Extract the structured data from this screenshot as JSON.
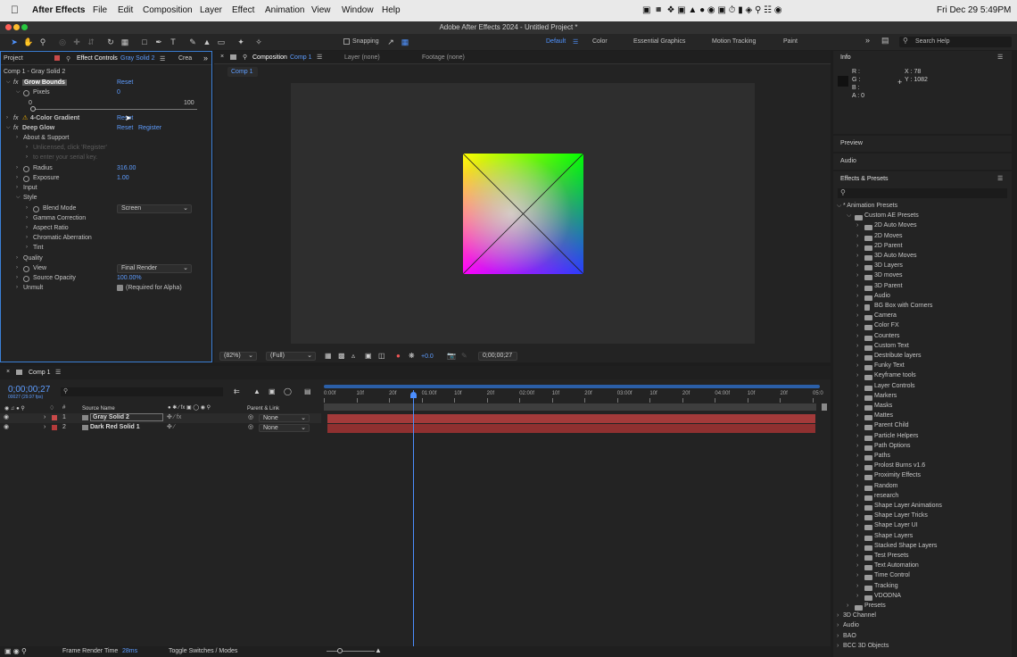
{
  "menubar": {
    "app_name": "After Effects",
    "items": [
      "File",
      "Edit",
      "Composition",
      "Layer",
      "Effect",
      "Animation",
      "View",
      "Window",
      "Help"
    ],
    "clock": "Fri Dec 29  5:49PM"
  },
  "window_title": "Adobe After Effects 2024 - Untitled Project *",
  "toolbar": {
    "snapping_label": "Snapping",
    "workspaces": [
      "Default",
      "Color",
      "Essential Graphics",
      "Motion Tracking",
      "Paint"
    ],
    "search_placeholder": "Search Help"
  },
  "effect_controls": {
    "tab_project": "Project",
    "tab_label": "Effect Controls",
    "tab_layer": "Gray Solid 2",
    "tab_extra": "Crea",
    "breadcrumb": "Comp 1 - Gray Solid 2",
    "rows": [
      {
        "indent": 0,
        "fx": true,
        "label": "Grow Bounds",
        "value": "Reset",
        "highlight": true
      },
      {
        "indent": 1,
        "stopwatch": true,
        "label": "Pixels",
        "value": "0"
      },
      {
        "indent": 1,
        "label": "",
        "value": ""
      },
      {
        "indent": 0,
        "fx": true,
        "warn": true,
        "label": "4-Color Gradient",
        "value": "Reset"
      },
      {
        "indent": 0,
        "fx": true,
        "label": "Deep Glow",
        "value": "Reset",
        "value2": "Register"
      },
      {
        "indent": 1,
        "label": "About & Support",
        "value": ""
      },
      {
        "indent": 2,
        "label": "Unlicensed, click 'Register'",
        "value": "",
        "dim": true
      },
      {
        "indent": 2,
        "label": "to enter your serial key.",
        "value": "",
        "dim": true
      },
      {
        "indent": 1,
        "stopwatch": true,
        "label": "Radius",
        "value": "316.00"
      },
      {
        "indent": 1,
        "stopwatch": true,
        "label": "Exposure",
        "value": "1.00"
      },
      {
        "indent": 1,
        "label": "Input",
        "value": ""
      },
      {
        "indent": 1,
        "label": "Style",
        "value": ""
      },
      {
        "indent": 2,
        "stopwatch": true,
        "label": "Blend Mode",
        "select": "Screen"
      },
      {
        "indent": 2,
        "label": "Gamma Correction",
        "value": ""
      },
      {
        "indent": 2,
        "label": "Aspect Ratio",
        "value": ""
      },
      {
        "indent": 2,
        "label": "Chromatic Aberration",
        "value": ""
      },
      {
        "indent": 2,
        "label": "Tint",
        "value": ""
      },
      {
        "indent": 1,
        "label": "Quality",
        "value": ""
      },
      {
        "indent": 1,
        "stopwatch": true,
        "label": "View",
        "select": "Final Render"
      },
      {
        "indent": 1,
        "stopwatch": true,
        "label": "Source Opacity",
        "value": "100.00%"
      },
      {
        "indent": 1,
        "label": "Unmult",
        "checkbox": "(Required for Alpha)"
      }
    ],
    "slider_min": "0",
    "slider_max": "100"
  },
  "composition": {
    "tab_label": "Composition",
    "tab_comp": "Comp 1",
    "tab_layer": "Layer (none)",
    "tab_footage": "Footage (none)",
    "subtab": "Comp 1",
    "zoom": "(82%)",
    "resolution": "(Full)",
    "exposure": "+0.0",
    "timecode": "0;00;00;27"
  },
  "info": {
    "title": "Info",
    "r": "R :",
    "g": "G :",
    "b": "B :",
    "a": "A :  0",
    "x": "X : 78",
    "y": "Y : 1082"
  },
  "side_panels": {
    "preview": "Preview",
    "audio": "Audio",
    "effects_presets": "Effects & Presets"
  },
  "presets": {
    "root": "* Animation Presets",
    "custom": "Custom AE Presets",
    "folders": [
      "2D Auto Moves",
      "2D Moves",
      "2D Parent",
      "3D Auto Moves",
      "3D Layers",
      "3D moves",
      "3D Parent",
      "Audio",
      "BG Box with Corners",
      "Camera",
      "Color FX",
      "Counters",
      "Custom Text",
      "Destribute layers",
      "Funky Text",
      "Keyframe tools",
      "Layer Controls",
      "Markers",
      "Masks",
      "Mattes",
      "Parent Child",
      "Particle Helpers",
      "Path Options",
      "Paths",
      "Prolost Burns v1.6",
      "Proximity Effects",
      "Random",
      "research",
      "Shape Layer Animations",
      "Shape Layer Tricks",
      "Shape Layer UI",
      "Shape Layers",
      "Stacked Shape Layers",
      "Test Presets",
      "Text Automation",
      "Time Control",
      "Tracking",
      "VDODNA"
    ],
    "presets_label": "Presets",
    "bottom": [
      "3D Channel",
      "Audio",
      "BAO",
      "BCC 3D Objects"
    ]
  },
  "timeline": {
    "tab": "Comp 1",
    "timecode": "0;00;00;27",
    "fps": "00027 (29.97 fps)",
    "col_source": "Source Name",
    "col_parent": "Parent & Link",
    "layers": [
      {
        "num": "1",
        "name": "Gray Solid 2",
        "parent": "None",
        "color": "#c94a4a"
      },
      {
        "num": "2",
        "name": "Dark Red Solid 1",
        "parent": "None",
        "color": "#b43b3b"
      }
    ],
    "ticks": [
      "0:00f",
      "10f",
      "20f",
      "01:00f",
      "10f",
      "20f",
      "02:00f",
      "10f",
      "20f",
      "03:00f",
      "10f",
      "20f",
      "04:00f",
      "10f",
      "20f",
      "05:0"
    ],
    "playhead": 0.18
  },
  "statusbar": {
    "render_label": "Frame Render Time",
    "render_value": "28ms",
    "toggle": "Toggle Switches / Modes"
  }
}
